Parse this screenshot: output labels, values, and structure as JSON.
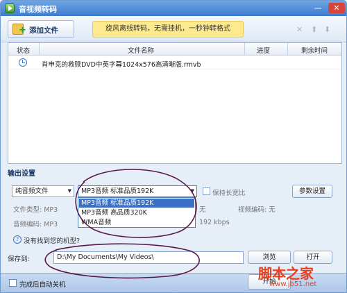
{
  "window": {
    "title": "音视频转码",
    "minimize": "—",
    "close": "✕"
  },
  "toolbar": {
    "add_file_label": "添加文件",
    "banner": "旋风离线转码，无需挂机，一秒钟转格式",
    "delete_icon": "✕",
    "up_icon": "⬆",
    "down_icon": "⬇"
  },
  "file_table": {
    "columns": [
      "状态",
      "文件名称",
      "进度",
      "剩余时间"
    ],
    "rows": [
      {
        "status_icon": "clock-icon",
        "name": "肖申克的救赎DVD中英字幕1024x576高清晰版.rmvb",
        "progress": "",
        "remaining": ""
      }
    ]
  },
  "output_settings": {
    "section_title": "输出设置",
    "type_value": "纯音频文件",
    "preset_value": "MP3音频 标准品质192K",
    "preset_options": [
      "MP3音频 标准品质192K",
      "MP3音频 高品质320K",
      "WMA音频"
    ],
    "keep_ratio_label": "保持长宽比",
    "param_button": "参数设置",
    "file_type_label": "文件类型: MP3",
    "audio_codec_label": "音频编码: MP3",
    "video_codec_label": "视频编码: 无",
    "resolution_fragment": "无",
    "bitrate_fragment": "192 kbps",
    "help_text": "没有找到您的机型?"
  },
  "save": {
    "label": "保存到:",
    "path": "D:\\My Documents\\My Videos\\",
    "browse_button": "浏览",
    "open_button": "打开"
  },
  "footer": {
    "shutdown_label": "完成后自动关机",
    "start_button": "开始"
  },
  "watermark": {
    "main": "脚本之家",
    "url": "www.jb51.net"
  },
  "annotation_color": "#5a1848"
}
